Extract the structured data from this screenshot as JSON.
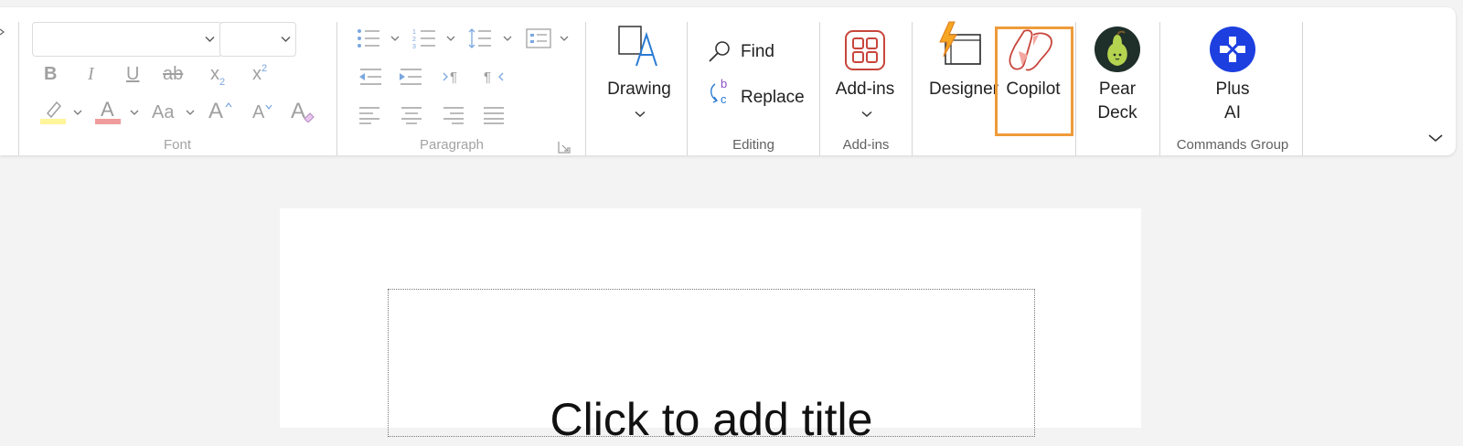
{
  "font_group": {
    "label": "Font",
    "font_name_value": "",
    "font_size_value": "",
    "bold": "B",
    "italic": "I",
    "underline": "U",
    "strikethrough": "ab",
    "subscript": "x",
    "subscript_sub": "2",
    "superscript": "x",
    "superscript_sup": "2",
    "change_case": "Aa",
    "grow_font": "A",
    "shrink_font": "A",
    "clear_formatting": "A"
  },
  "paragraph_group": {
    "label": "Paragraph"
  },
  "drawing_group": {
    "drawing_label": "Drawing"
  },
  "editing_group": {
    "label": "Editing",
    "find_label": "Find",
    "replace_label": "Replace"
  },
  "addins_group": {
    "label": "Add-ins",
    "addins_button_label": "Add-ins"
  },
  "designer_label": "Designer",
  "copilot_label": "Copilot",
  "pear_deck": {
    "line1": "Pear",
    "line2": "Deck"
  },
  "commands_group": {
    "label": "Commands Group",
    "plus_line1": "Plus",
    "plus_line2": "AI"
  },
  "slide": {
    "title_placeholder": "Click to add title"
  },
  "colors": {
    "accent_highlight_box": "#ee9b3a",
    "highlight_yellow": "#fff59a",
    "font_color_red": "#f19c9c",
    "plus_ai_blue": "#1d3fe0",
    "pear_deck_bg": "#1f2f2a",
    "pear_green": "#b4d34f"
  },
  "icons": [
    "bullets-icon",
    "numbering-icon",
    "line-spacing-icon",
    "text-direction-icon",
    "decrease-indent-icon",
    "increase-indent-icon",
    "ltr-icon",
    "rtl-icon",
    "align-left-icon",
    "align-center-icon",
    "align-right-icon",
    "justify-icon",
    "dialog-launcher-icon",
    "drawing-icon",
    "search-icon",
    "replace-icon",
    "addins-grid-icon",
    "designer-icon",
    "copilot-icon",
    "pear-deck-icon",
    "plus-ai-icon",
    "collapse-ribbon-icon"
  ]
}
